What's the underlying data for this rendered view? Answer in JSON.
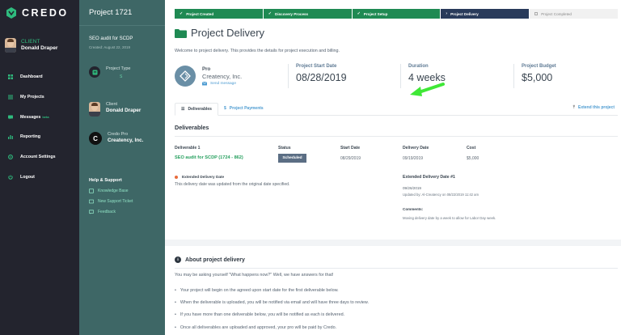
{
  "app": {
    "logo_text": "CREDO",
    "accent_color": "#2fbb7e",
    "nav_bg": "#23242e",
    "panel_bg": "#3e6766"
  },
  "nav": {
    "user_role": "CLIENT",
    "user_name": "Donald Draper",
    "items": [
      {
        "label": "Dashboard",
        "icon": "dashboard-icon"
      },
      {
        "label": "My Projects",
        "icon": "projects-icon"
      },
      {
        "label": "Messages",
        "badge": "beta",
        "icon": "messages-icon"
      },
      {
        "label": "Reporting",
        "icon": "reporting-icon"
      },
      {
        "label": "Account Settings",
        "icon": "settings-icon"
      },
      {
        "label": "Logout",
        "icon": "logout-icon"
      }
    ]
  },
  "project_panel": {
    "header": "Project 1721",
    "name": "SEO audit for SCDP",
    "created": "Created: August 22, 2019",
    "type_label": "Project Type",
    "type_value": "S",
    "client_label": "Client",
    "client_name": "Donald Draper",
    "pro_label": "Credo Pro",
    "pro_name": "Creatency, Inc.",
    "help_title": "Help & Support",
    "help_links": [
      "Knowledge Base",
      "New Support Ticket",
      "Feedback"
    ]
  },
  "steps": [
    {
      "label": "Project Created",
      "state": "done"
    },
    {
      "label": "Discovery Process",
      "state": "done"
    },
    {
      "label": "Project Setup",
      "state": "done"
    },
    {
      "label": "Project Delivery",
      "state": "current"
    },
    {
      "label": "Project Completed",
      "state": "todo"
    }
  ],
  "page": {
    "title": "Project Delivery",
    "intro": "Welcome to project delivery. This provides the details for project execution and billing."
  },
  "pro_card": {
    "label": "Pro",
    "name": "Creatency, Inc.",
    "send_message": "Send message"
  },
  "stats": [
    {
      "label": "Project Start Date",
      "value": "08/28/2019"
    },
    {
      "label": "Duration",
      "value": "4 weeks"
    },
    {
      "label": "Project Budget",
      "value": "$5,000"
    }
  ],
  "tabs": [
    {
      "label": "Deliverables",
      "active": true
    },
    {
      "label": "Project Payments",
      "active": false
    }
  ],
  "extend_link": "Extend this project",
  "deliverables": {
    "title": "Deliverables",
    "columns": [
      "Deliverable 1",
      "Status",
      "Start Date",
      "Delivery Date",
      "Cost"
    ],
    "row": {
      "name": "SEO audit for SCDP (1724 - 862)",
      "status": "Scheduled",
      "start_date": "08/29/2019",
      "delivery_date": "09/19/2019",
      "cost": "$5,000"
    },
    "extended_label": "Extended Delivery Date",
    "extended_note": "This delivery date was updated from the original date specified.",
    "extended_title": "Extended Delivery Date #1",
    "extended_date": "09/26/2019",
    "extended_updated": "Updated by: Al-Creatency on 08/22/2019 11:42 am",
    "comments_label": "Comments:",
    "comment_text": "Moving delivery date by a week to allow for Labor Day week."
  },
  "about": {
    "title": "About project delivery",
    "intro": "You may be asking yourself \"What happens now?\" Well, we have answers for that!",
    "items": [
      "Your project will begin on the agreed upon start date for the first deliverable below.",
      "When the deliverable is uploaded, you will be notified via email and will have three days to review.",
      "If you have more than one deliverable below, you will be notified as each is delivered.",
      "Once all deliverables are uploaded and approved, your pro will be paid by Credo."
    ]
  }
}
